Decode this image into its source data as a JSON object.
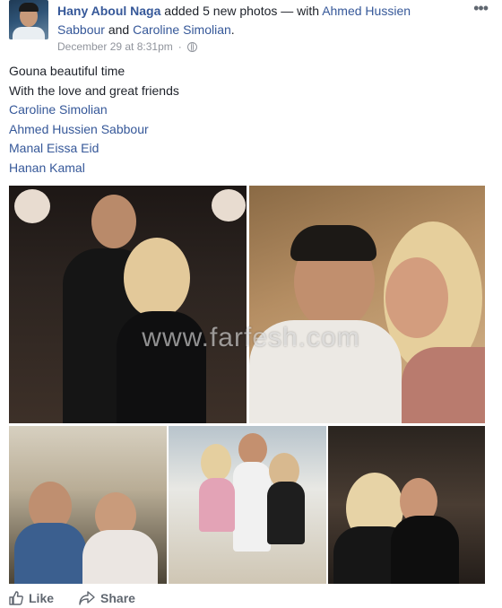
{
  "post": {
    "author": "Hany Aboul Naga",
    "action_text": " added 5 new photos — with ",
    "tagged_1": "Ahmed Hussien Sabbour",
    "and_text": " and ",
    "tagged_2": "Caroline Simolian",
    "period": ".",
    "timestamp": "December 29 at 8:31pm",
    "separator": "·",
    "privacy_icon": "globe-icon",
    "more_icon": "more-options-icon",
    "lines": [
      "Gouna beautiful time",
      "With the love and great friends"
    ],
    "tags": [
      "Caroline Simolian",
      "Ahmed Hussien Sabbour",
      "Manal Eissa Eid",
      "Hanan Kamal"
    ]
  },
  "photos": {
    "count": 5,
    "watermark": "www.farfesh.com"
  },
  "actions": {
    "like_label": "Like",
    "share_label": "Share"
  },
  "colors": {
    "link": "#365899",
    "text": "#1d2129",
    "meta": "#90949c",
    "action": "#606770"
  }
}
